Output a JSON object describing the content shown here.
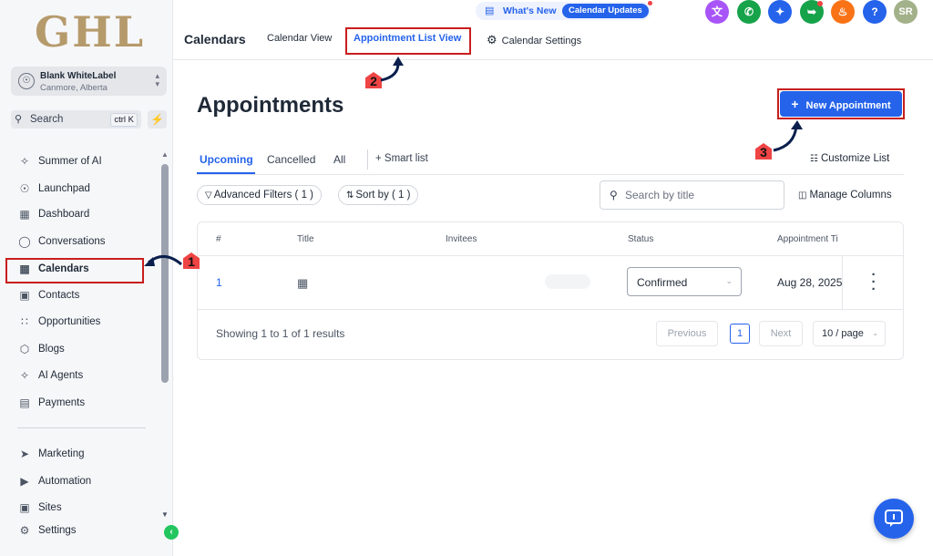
{
  "brand": {
    "logo_text": "GHL"
  },
  "account": {
    "name": "Blank WhiteLabel",
    "location": "Canmore, Alberta"
  },
  "sidebar": {
    "search_label": "Search",
    "search_shortcut": "ctrl K",
    "items": [
      {
        "label": "Summer of AI",
        "icon": "sparkle-icon"
      },
      {
        "label": "Launchpad",
        "icon": "rocket-icon"
      },
      {
        "label": "Dashboard",
        "icon": "grid-icon"
      },
      {
        "label": "Conversations",
        "icon": "chat-bubble-icon"
      },
      {
        "label": "Calendars",
        "icon": "calendar-icon"
      },
      {
        "label": "Contacts",
        "icon": "contact-card-icon"
      },
      {
        "label": "Opportunities",
        "icon": "network-icon"
      },
      {
        "label": "Blogs",
        "icon": "cube-icon"
      },
      {
        "label": "AI Agents",
        "icon": "sparkle-icon"
      },
      {
        "label": "Payments",
        "icon": "receipt-icon"
      }
    ],
    "bottom_items": [
      {
        "label": "Marketing",
        "icon": "send-icon"
      },
      {
        "label": "Automation",
        "icon": "play-circle-icon"
      },
      {
        "label": "Sites",
        "icon": "browser-icon"
      },
      {
        "label": "Settings",
        "icon": "gear-icon"
      }
    ]
  },
  "topbar": {
    "whats_new": "What's New",
    "calendar_updates": "Calendar Updates",
    "section_title": "Calendars",
    "tabs": [
      {
        "label": "Calendar View"
      },
      {
        "label": "Appointment List View"
      },
      {
        "label": "Calendar Settings"
      }
    ],
    "user_initials": "SR",
    "icon_colors": {
      "translate": "#a855f7",
      "phone": "#16a34a",
      "magic": "#2563eb",
      "megaphone": "#16a34a",
      "bell": "#f97316",
      "help": "#2563eb",
      "avatar": "#a3b18a"
    }
  },
  "main": {
    "title": "Appointments",
    "new_button": "New Appointment",
    "tabs": [
      "Upcoming",
      "Cancelled",
      "All"
    ],
    "smart_list": "+ Smart list",
    "customize_list": "Customize List",
    "filters": {
      "advanced": "Advanced Filters ( 1 )",
      "sort": "Sort by ( 1 )"
    },
    "search_placeholder": "Search by title",
    "manage_columns": "Manage Columns",
    "table": {
      "headers": [
        "#",
        "Title",
        "Invitees",
        "Status",
        "Appointment Ti"
      ],
      "rows": [
        {
          "num": "1",
          "status": "Confirmed",
          "appointment_time": "Aug 28, 2025"
        }
      ]
    },
    "pagination": {
      "showing": "Showing 1 to 1 of 1 results",
      "previous": "Previous",
      "current": "1",
      "next": "Next",
      "per_page": "10 / page"
    }
  },
  "annotations": {
    "step1": "1",
    "step2": "2",
    "step3": "3"
  },
  "colors": {
    "primary": "#2563eb",
    "highlight": "#c81e1e",
    "success": "#22c55e"
  }
}
